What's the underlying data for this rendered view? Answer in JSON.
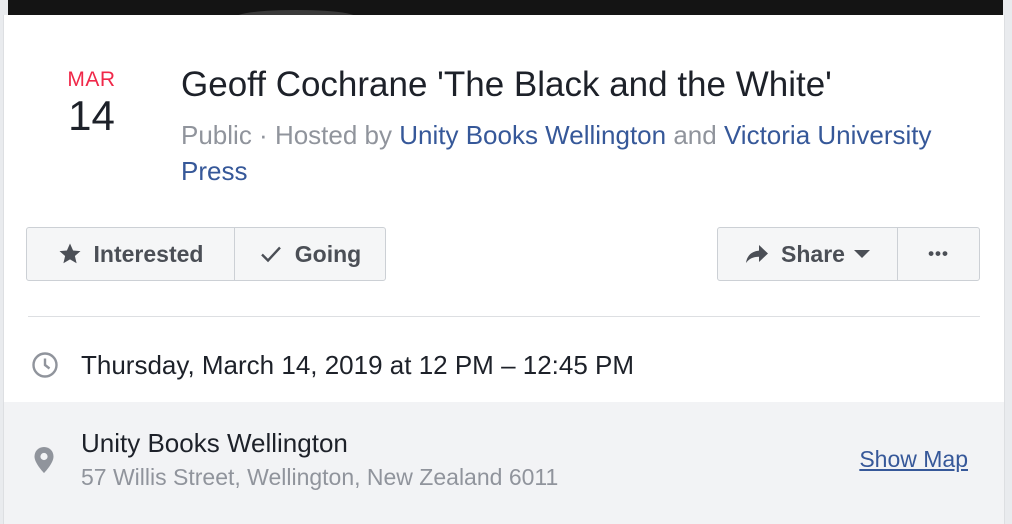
{
  "event": {
    "month": "MAR",
    "day": "14",
    "title": "Geoff Cochrane 'The Black and the White'",
    "privacy": "Public",
    "separator": " · ",
    "hosted_by_prefix": "Hosted by ",
    "host_1": "Unity Books Wellington",
    "host_joiner": " and ",
    "host_2": "Victoria University Press"
  },
  "actions": {
    "interested_label": "Interested",
    "going_label": "Going",
    "share_label": "Share",
    "more_label": "•••"
  },
  "details": {
    "datetime": "Thursday, March 14, 2019 at 12 PM – 12:45 PM",
    "venue_name": "Unity Books Wellington",
    "venue_address": "57 Willis Street, Wellington, New Zealand 6011",
    "show_map_label": "Show Map"
  },
  "icons": {
    "interested": "star-icon",
    "going": "check-icon",
    "share": "share-arrow-icon",
    "share_dropdown": "caret-down-icon",
    "time": "clock-icon",
    "location": "map-pin-icon"
  },
  "colors": {
    "month": "#f02849",
    "link": "#365899",
    "muted": "#90949c",
    "button_bg": "#f5f6f7",
    "button_text": "#4b4f56",
    "location_row_bg": "#f2f3f5"
  }
}
